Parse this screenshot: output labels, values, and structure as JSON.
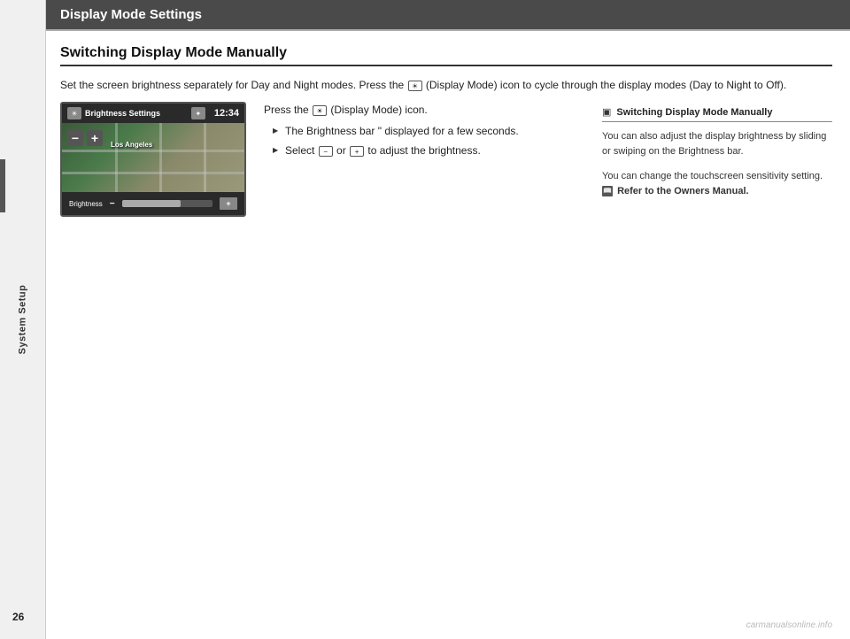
{
  "sidebar": {
    "label": "System Setup"
  },
  "page": {
    "number": "26"
  },
  "header": {
    "title": "Display Mode Settings"
  },
  "section": {
    "title": "Switching Display Mode Manually",
    "intro": "Set the screen brightness separately for Day and Night modes. Press the",
    "intro2": "(Display Mode) icon to cycle through the display modes (Day to Night to Off).",
    "instruction_line1": "Press the",
    "instruction_icon": "☀",
    "instruction_line1b": "(Display Mode) icon.",
    "bullets": [
      "The Brightness bar is displayed for a few seconds.",
      "Select — or + to adjust the brightness."
    ],
    "select_label": "Select"
  },
  "screen": {
    "header_text": "Brightness Settings",
    "header_icon": "☀",
    "time": "12:34",
    "city_label": "Los Angeles",
    "brightness_label": "Brightness"
  },
  "info_box": {
    "header": "Switching Display Mode Manually",
    "para1": "You can also adjust the display brightness by sliding or swiping on the Brightness bar.",
    "para2": "You can change the touchscreen sensitivity setting.",
    "para3": "Refer to the Owners Manual."
  },
  "watermark": "carmanualsonline.info"
}
